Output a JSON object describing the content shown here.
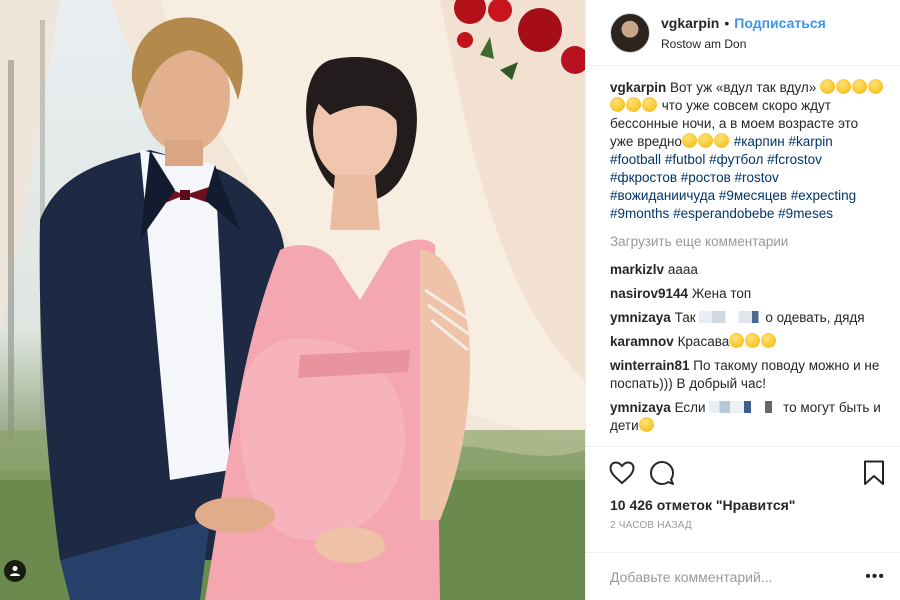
{
  "post": {
    "photo_alt": "",
    "header": {
      "username": "vgkarpin",
      "follow_label": "Подписаться",
      "location": "Rostow am Don"
    },
    "caption": {
      "username": "vgkarpin",
      "text_1": "Вот уж «вдул так вдул»",
      "text_2": "что уже совсем скоро ждут бессонные ночи, а в моем возрасте это уже вредно",
      "hashtags": [
        "#карпин",
        "#karpin",
        "#football",
        "#futbol",
        "#футбол",
        "#fcrostov",
        "#фкростов",
        "#ростов",
        "#rostov",
        "#вожиданиичуда",
        "#9месяцев",
        "#expecting",
        "#9months",
        "#esperandobebe",
        "#9meses"
      ]
    },
    "load_more_label": "Загрузить еще комментарии",
    "comments": [
      {
        "user": "markizlv",
        "text": "аааа"
      },
      {
        "user": "nasirov9144",
        "text": "Жена топ"
      },
      {
        "user": "ymnizaya",
        "text_before": "Так",
        "text_after": "о одевать, дядя"
      },
      {
        "user": "karamnov",
        "text": "Красава"
      },
      {
        "user": "winterrain81",
        "text": "По такому поводу можно и не поспать))) В добрый час!"
      },
      {
        "user": "ymnizaya",
        "text_before": "Если",
        "text_after": "то могут быть и дети"
      }
    ],
    "likes_label": "10 426 отметок \"Нравится\"",
    "time_label": "2 ЧАСОВ НАЗАД",
    "add_comment_placeholder": "Добавьте комментарий...",
    "more_label": "•••"
  },
  "colors": {
    "link_blue": "#3897f0",
    "hashtag": "#003569",
    "dress_pink": "#f4a7b0"
  },
  "icons": [
    "heart-icon",
    "comment-icon",
    "bookmark-icon",
    "user-tag-icon"
  ]
}
